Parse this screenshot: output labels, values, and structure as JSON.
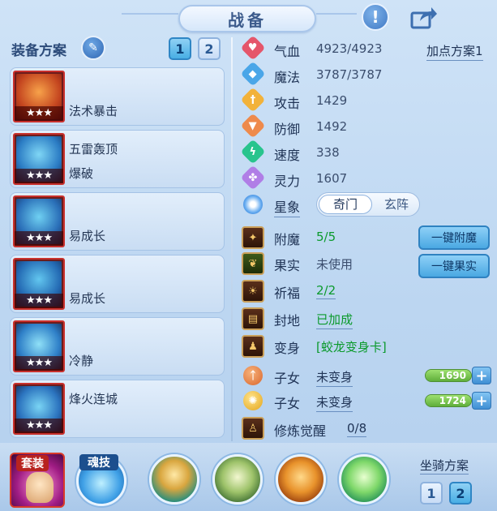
{
  "header": {
    "title": "战备"
  },
  "equipment": {
    "title": "装备方案",
    "plans": [
      "1",
      "2"
    ],
    "active_plan": "1",
    "items": [
      {
        "line1": "",
        "line2": "法术暴击",
        "stars": "★★★"
      },
      {
        "line1": "五雷轰顶",
        "line2": "爆破",
        "stars": "★★★"
      },
      {
        "line1": "",
        "line2": "易成长",
        "stars": "★★★"
      },
      {
        "line1": "",
        "line2": "易成长",
        "stars": "★★★"
      },
      {
        "line1": "",
        "line2": "冷静",
        "stars": "★★★"
      },
      {
        "line1": "烽火连城",
        "line2": "",
        "stars": "★★★"
      }
    ]
  },
  "stats": {
    "plan_link": "加点方案1",
    "rows": [
      {
        "label": "气血",
        "value": "4923/4923",
        "icon": "heart-icon",
        "color": "#e5566b"
      },
      {
        "label": "魔法",
        "value": "3787/3787",
        "icon": "mana-icon",
        "color": "#4aa6e8"
      },
      {
        "label": "攻击",
        "value": "1429",
        "icon": "sword-icon",
        "color": "#f2b23a"
      },
      {
        "label": "防御",
        "value": "1492",
        "icon": "shield-icon",
        "color": "#ee8a4c"
      },
      {
        "label": "速度",
        "value": "338",
        "icon": "lightning-icon",
        "color": "#28c48d"
      },
      {
        "label": "灵力",
        "value": "1607",
        "icon": "spirit-icon",
        "color": "#b07ee6"
      }
    ],
    "xingxiang": {
      "label": "星象",
      "options": [
        "奇门",
        "玄阵"
      ],
      "selected": "奇门"
    }
  },
  "enhance": {
    "rows": [
      {
        "label": "附魔",
        "value": "5/5",
        "green": true,
        "underline": false
      },
      {
        "label": "果实",
        "value": "未使用",
        "green": false,
        "underline": false
      },
      {
        "label": "祈福",
        "value": "2/2",
        "green": true,
        "underline": true
      },
      {
        "label": "封地",
        "value": "已加成",
        "green": true,
        "underline": true
      },
      {
        "label": "变身",
        "value": "[蛟龙变身卡]",
        "green": true,
        "underline": false
      }
    ],
    "buttons": {
      "enchant": "一键附魔",
      "fruit": "一键果实"
    }
  },
  "children": [
    {
      "label": "子女",
      "status": "未变身",
      "value": "1690",
      "fill": 1.0
    },
    {
      "label": "子女",
      "status": "未变身",
      "value": "1724",
      "fill": 1.0
    }
  ],
  "awaken": {
    "label": "修炼觉醒",
    "value": "0/8"
  },
  "bottom": {
    "set_label": "套装",
    "soul_skill_label": "魂技",
    "mount_title": "坐骑方案",
    "mount_plans": [
      "1",
      "2"
    ],
    "active_mount": "2"
  },
  "colors": {
    "accent": "#48aee4",
    "green_text": "#0b9a2c",
    "equip_border": "#c9302c"
  }
}
